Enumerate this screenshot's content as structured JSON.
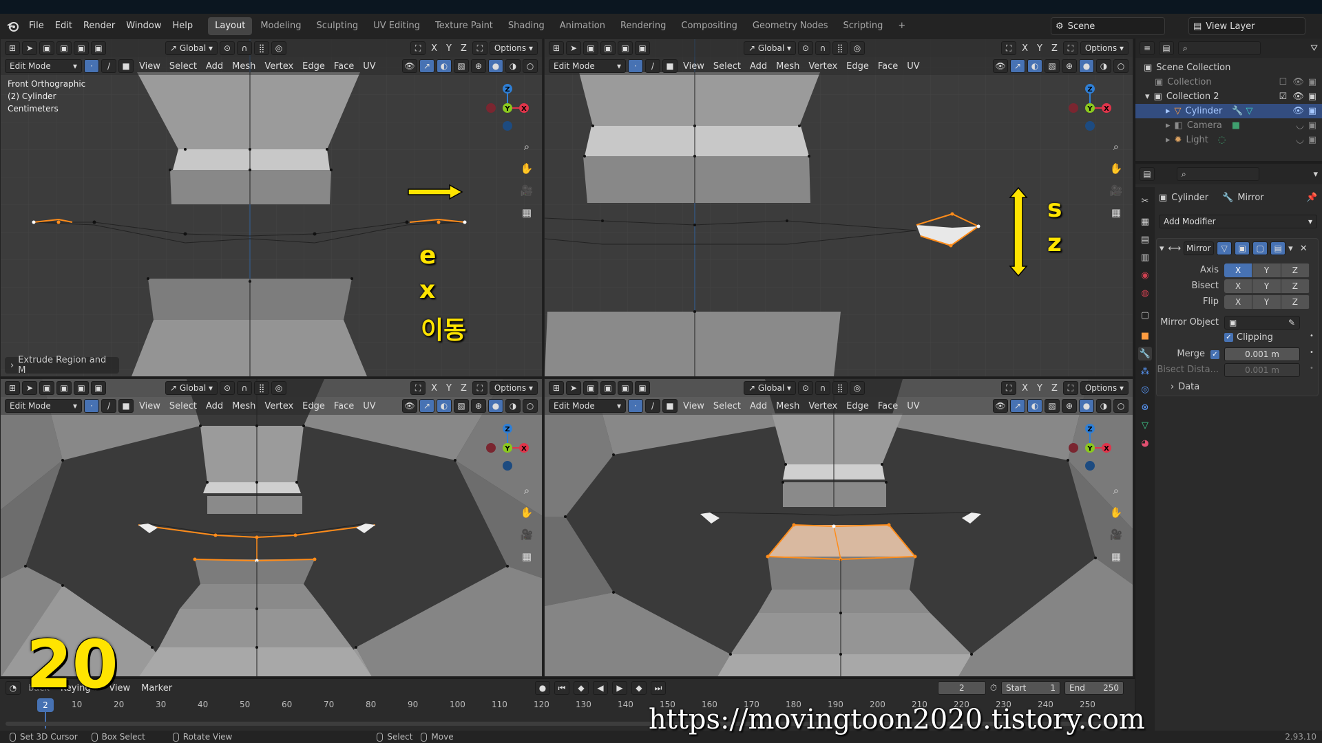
{
  "menubar": {
    "items": [
      "File",
      "Edit",
      "Render",
      "Window",
      "Help"
    ],
    "tabs": [
      "Layout",
      "Modeling",
      "Sculpting",
      "UV Editing",
      "Texture Paint",
      "Shading",
      "Animation",
      "Rendering",
      "Compositing",
      "Geometry Nodes",
      "Scripting"
    ],
    "active_tab": "Layout",
    "add_tab": "+",
    "scene": "Scene",
    "view_layer": "View Layer"
  },
  "viewport_header": {
    "orientation": "Global",
    "axes": [
      "X",
      "Y",
      "Z"
    ],
    "options": "Options",
    "mode": "Edit Mode",
    "menus": [
      "View",
      "Select",
      "Add",
      "Mesh",
      "Vertex",
      "Edge",
      "Face",
      "UV"
    ]
  },
  "viewports": {
    "tl": {
      "overlay": [
        "Front Orthographic",
        "(2) Cylinder",
        "Centimeters"
      ],
      "last_operator": "Extrude Region and M"
    }
  },
  "annotations": {
    "left_keys": [
      "e",
      "x",
      "이동"
    ],
    "right_keys": [
      "s",
      "z"
    ]
  },
  "outliner": {
    "rows": [
      {
        "label": "Scene Collection",
        "indent": 0
      },
      {
        "label": "Collection",
        "indent": 1,
        "dim": true
      },
      {
        "label": "Collection 2",
        "indent": 1
      },
      {
        "label": "Cylinder",
        "indent": 2,
        "selected": true
      },
      {
        "label": "Camera",
        "indent": 2,
        "dim": true
      },
      {
        "label": "Light",
        "indent": 2,
        "dim": true
      }
    ]
  },
  "properties": {
    "object": "Cylinder",
    "modifier_crumb": "Mirror",
    "add_modifier": "Add Modifier",
    "modifier_name": "Mirror",
    "axis_label": "Axis",
    "bisect_label": "Bisect",
    "flip_label": "Flip",
    "axes": [
      "X",
      "Y",
      "Z"
    ],
    "mirror_object_label": "Mirror Object",
    "clipping_label": "Clipping",
    "merge_label": "Merge",
    "merge_value": "0.001 m",
    "bisect_distance_label": "Bisect Dista...",
    "bisect_distance_value": "0.001 m",
    "data_label": "Data"
  },
  "timeline": {
    "menus": [
      "Keying",
      "View",
      "Marker"
    ],
    "playback_partial": "back",
    "current_frame": "2",
    "start_label": "Start",
    "start_value": "1",
    "end_label": "End",
    "end_value": "250",
    "ticks": [
      "10",
      "20",
      "30",
      "40",
      "50",
      "60",
      "70",
      "80",
      "90",
      "100",
      "110",
      "120",
      "130",
      "140",
      "150",
      "160",
      "170",
      "180",
      "190",
      "200",
      "210",
      "220",
      "230",
      "240",
      "250"
    ],
    "marker_frame": "2"
  },
  "statusbar": {
    "items": [
      "Set 3D Cursor",
      "Box Select",
      "Rotate View",
      "Select",
      "Move"
    ],
    "version": "2.93.10"
  },
  "overlay_frame_number": "20",
  "watermark_url": "https://movingtoon2020.tistory.com",
  "colors": {
    "accent": "#4772b3",
    "selection": "#ff8c1a",
    "annotation": "#ffe400",
    "axis_x": "#e0344a",
    "axis_y": "#8bc81f",
    "axis_z": "#2f7fd6"
  }
}
